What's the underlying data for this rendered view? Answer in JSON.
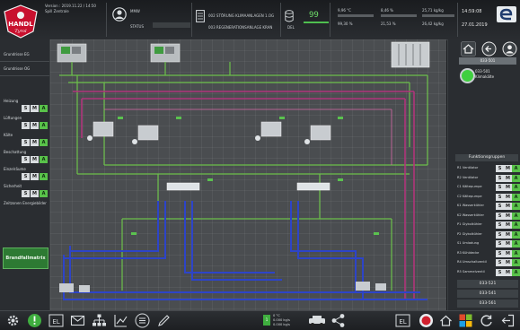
{
  "header": {
    "logo_text": "HANDL Tyrol",
    "user_lines": [
      "Version : 2019.11.22 / 14:50",
      "Spill Zentrale"
    ],
    "status_lines": [
      "MMW",
      "STATUS"
    ],
    "doc_lines": [
      "002 STÖRUNG KLIMAANLAGEN 1.OG",
      "003 REGENERATIONSANLAGE KRAN"
    ],
    "db_label": "DEL",
    "counter_value": "99",
    "meter_labels": [
      "9,96 °C",
      "8,46 %",
      "25,71 kg/kg",
      "99,30 %",
      "21,53 %",
      "26,42 kg/kg"
    ],
    "time": "14:59:08",
    "date": "27.01.2019"
  },
  "left": {
    "headers": [
      "Grundrisse EG",
      "Grundrisse OG"
    ],
    "controls": [
      {
        "label": "Heizung",
        "s": "S",
        "m": "M",
        "a": "A"
      },
      {
        "label": "Lüftungen",
        "s": "S",
        "m": "M",
        "a": "A"
      },
      {
        "label": "Kälte",
        "s": "S",
        "m": "M",
        "a": "A"
      },
      {
        "label": "Beschattung",
        "s": "S",
        "m": "M",
        "a": "A"
      },
      {
        "label": "Einzelräume",
        "s": "S",
        "m": "M",
        "a": "A"
      },
      {
        "label": "Sicherheit",
        "s": "S",
        "m": "M",
        "a": "A"
      }
    ],
    "extra_label": "Zeitzonen Energiebilder",
    "alarm_button": "Brandfallmatrix"
  },
  "right": {
    "tab_label": "033-501",
    "lamp_label_top": "033-501",
    "lamp_label_bottom": "Klimakälte",
    "function_group_title": "Funktionsgruppen",
    "function_groups": [
      {
        "label": "R1 Ventilator",
        "s": "S",
        "m": "M",
        "a": "A"
      },
      {
        "label": "R2 Ventilator",
        "s": "S",
        "m": "M",
        "a": "A"
      },
      {
        "label": "C1 Kältepumpe",
        "s": "S",
        "m": "M",
        "a": "A"
      },
      {
        "label": "C2 Kältepumpe",
        "s": "S",
        "m": "M",
        "a": "A"
      },
      {
        "label": "K1 Wasserkühler",
        "s": "S",
        "m": "M",
        "a": "A"
      },
      {
        "label": "K2 Wasserkühler",
        "s": "S",
        "m": "M",
        "a": "A"
      },
      {
        "label": "P1 Glykolkühler",
        "s": "S",
        "m": "M",
        "a": "A"
      },
      {
        "label": "P2 Glykolkühler",
        "s": "S",
        "m": "M",
        "a": "A"
      },
      {
        "label": "S1 Umladung",
        "s": "S",
        "m": "M",
        "a": "A"
      },
      {
        "label": "R3 Kühldecke",
        "s": "S",
        "m": "M",
        "a": "A"
      },
      {
        "label": "R4 Umschaltventil",
        "s": "S",
        "m": "M",
        "a": "A"
      },
      {
        "label": "R5 Sammelventil",
        "s": "S",
        "m": "M",
        "a": "A"
      }
    ],
    "bottom_tabs": [
      "033-521",
      "033-541",
      "033-561"
    ]
  },
  "footer": {
    "indicator": "1",
    "readout_lines": [
      "0 °C",
      "0.000 kg/s",
      "0.000 kg/s"
    ]
  },
  "colors": {
    "accent_green": "#59c24a",
    "pipe_green": "#6cc04a",
    "pipe_magenta": "#b0357a",
    "pipe_blue": "#2d44c8",
    "pipe_pink": "#d86aa8"
  }
}
